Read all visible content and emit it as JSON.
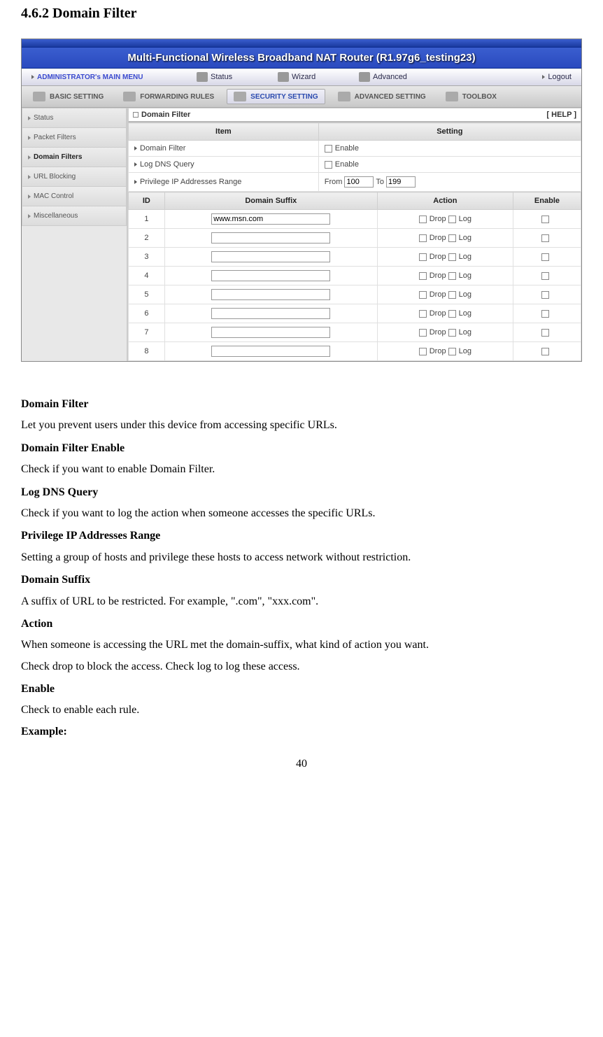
{
  "section_title": "4.6.2 Domain Filter",
  "product_bar": "Multi-Functional Wireless Broadband NAT Router (R1.97g6_testing23)",
  "menu": {
    "admin": "ADMINISTRATOR's MAIN MENU",
    "status": "Status",
    "wizard": "Wizard",
    "advanced": "Advanced",
    "logout": "Logout"
  },
  "tabs": {
    "basic": "BASIC SETTING",
    "forwarding": "FORWARDING RULES",
    "security": "SECURITY SETTING",
    "advanced": "ADVANCED SETTING",
    "toolbox": "TOOLBOX"
  },
  "sidebar": {
    "items": [
      {
        "label": "Status"
      },
      {
        "label": "Packet Filters"
      },
      {
        "label": "Domain Filters"
      },
      {
        "label": "URL Blocking"
      },
      {
        "label": "MAC Control"
      },
      {
        "label": "Miscellaneous"
      }
    ]
  },
  "panel": {
    "title": "Domain Filter",
    "help": "[ HELP ]",
    "col_item": "Item",
    "col_setting": "Setting",
    "items": {
      "domain_filter": "Domain Filter",
      "log_dns": "Log DNS Query",
      "priv_ip": "Privilege IP Addresses Range"
    },
    "enable_label": "Enable",
    "from_label": "From",
    "to_label": "To",
    "from_val": "100",
    "to_val": "199",
    "col_id": "ID",
    "col_suffix": "Domain Suffix",
    "col_action": "Action",
    "col_enable": "Enable",
    "drop_label": "Drop",
    "log_label": "Log",
    "rows": [
      {
        "id": "1",
        "suffix": "www.msn.com"
      },
      {
        "id": "2",
        "suffix": ""
      },
      {
        "id": "3",
        "suffix": ""
      },
      {
        "id": "4",
        "suffix": ""
      },
      {
        "id": "5",
        "suffix": ""
      },
      {
        "id": "6",
        "suffix": ""
      },
      {
        "id": "7",
        "suffix": ""
      },
      {
        "id": "8",
        "suffix": ""
      }
    ]
  },
  "doc": {
    "h_domain_filter": "Domain Filter",
    "p_domain_filter": "Let you prevent users under this device from accessing specific URLs.",
    "h_domain_filter_enable": "Domain Filter Enable",
    "p_domain_filter_enable": "Check if you want to enable Domain Filter.",
    "h_log_dns": "Log DNS Query",
    "p_log_dns": "Check if you want to log the action when someone accesses the specific URLs.",
    "h_priv_ip": "Privilege IP Addresses Range",
    "p_priv_ip": "Setting a group of hosts and privilege these hosts to access network without restriction.",
    "h_suffix": "Domain Suffix",
    "p_suffix": "A suffix of URL to be restricted. For example, \".com\", \"xxx.com\".",
    "h_action": "Action",
    "p_action1": "When someone is accessing the URL met the domain-suffix, what kind of action you want.",
    "p_action2": "Check drop to block the access. Check log to log these access.",
    "h_enable": "Enable",
    "p_enable": "Check to enable each rule.",
    "example": "Example:"
  },
  "page_num": "40"
}
